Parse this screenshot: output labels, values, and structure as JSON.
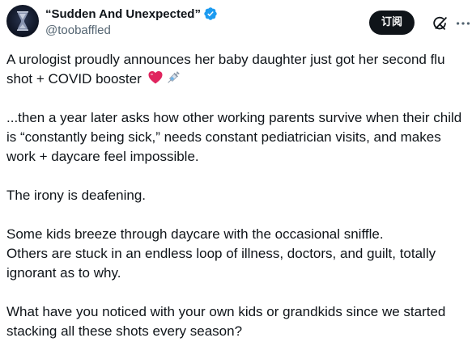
{
  "author": {
    "display_name": "“Sudden And Unexpected”",
    "handle": "@toobaffled",
    "verified_icon": "verified-badge-icon",
    "avatar_icon": "hourglass-avatar"
  },
  "actions": {
    "subscribe_label": "订阅",
    "grok_icon": "grok-icon",
    "more_icon": "more-options-icon"
  },
  "tweet": {
    "paragraph_1": "A urologist proudly announces her baby daughter just got her second flu shot + COVID booster",
    "paragraph_1_emojis": [
      "red-heart-emoji",
      "syringe-emoji"
    ],
    "paragraph_2": "...then a year later asks how other working parents survive when their child is “constantly being sick,” needs constant pediatrician visits, and makes work + daycare feel impossible.",
    "paragraph_3": "The irony is deafening.",
    "paragraph_4_line_1": "Some kids breeze through daycare with the occasional sniffle.",
    "paragraph_4_line_2": "Others are stuck in an endless loop of illness, doctors, and guilt, totally ignorant as to why.",
    "paragraph_5": "What have you noticed with your own kids or grandkids since we started stacking all these shots every season?"
  },
  "colors": {
    "text_primary": "#0f1419",
    "text_secondary": "#536471",
    "verified_blue": "#1d9bf0",
    "button_bg": "#0f1419",
    "heart_red": "#e0245e"
  }
}
